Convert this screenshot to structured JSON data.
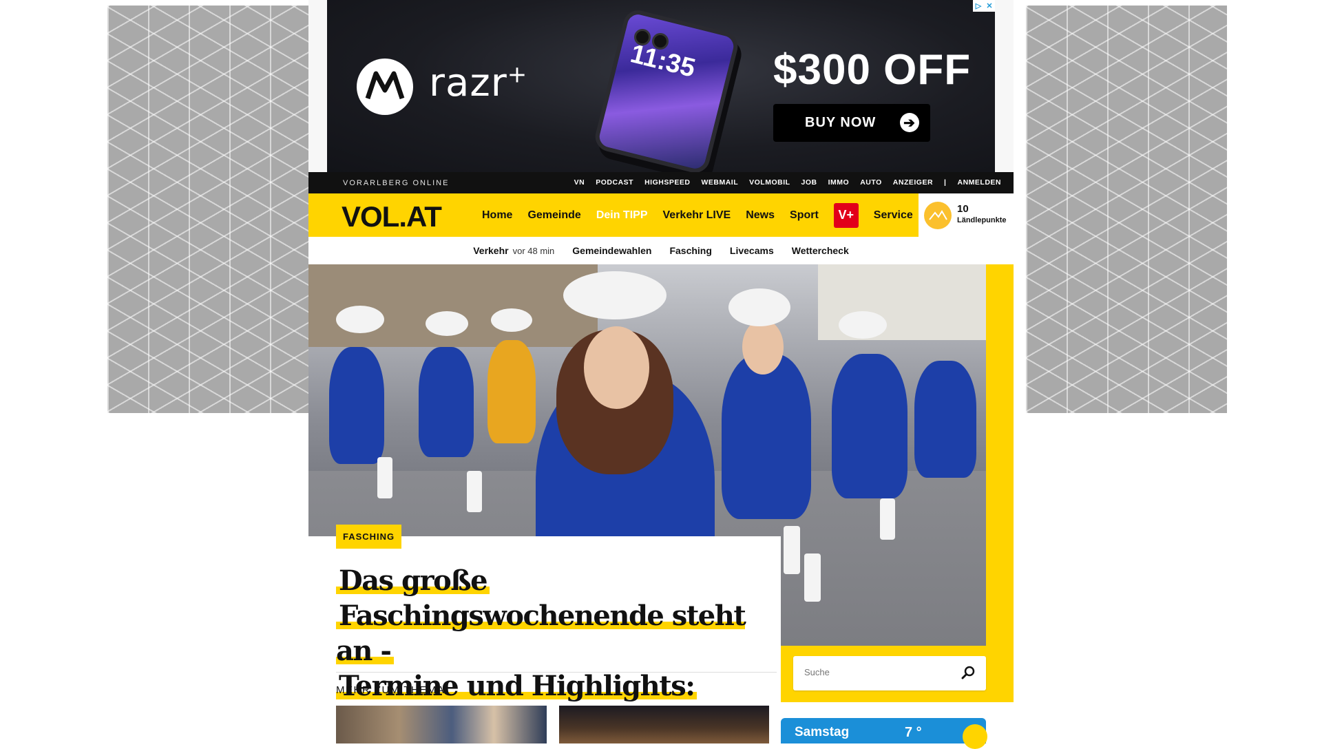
{
  "ad": {
    "brand": "razr",
    "brand_sup": "+",
    "phone_time": "11:35",
    "offer": "$300 OFF",
    "cta": "BUY NOW",
    "choices": [
      "▷",
      "✕"
    ]
  },
  "topbar": {
    "brand": "VORARLBERG ONLINE",
    "links": [
      "VN",
      "PODCAST",
      "HIGHSPEED",
      "WEBMAIL",
      "VOLMOBIL",
      "JOB",
      "IMMO",
      "AUTO",
      "ANZEIGER"
    ],
    "separator": "|",
    "login": "ANMELDEN"
  },
  "mainnav": {
    "logo": "VOL.AT",
    "links": [
      "Home",
      "Gemeinde",
      "Dein TIPP",
      "Verkehr LIVE",
      "News",
      "Sport"
    ],
    "vplus": "V+",
    "service": "Service",
    "points_value": "10",
    "points_label": "Ländlepunkte"
  },
  "subnav": {
    "items": [
      "Verkehr",
      "Gemeindewahlen",
      "Fasching",
      "Livecams",
      "Wettercheck"
    ],
    "verkehr_time": "vor 48 min"
  },
  "article": {
    "tag": "FASCHING",
    "headline_lines": [
      "Das große",
      "Faschingswochenende steht an -",
      "Termine und Highlights:"
    ],
    "mehr_label": "MEHR ZUM THEMA:"
  },
  "search": {
    "placeholder": "Suche"
  },
  "weather": {
    "day": "Samstag",
    "temp": "7 °"
  },
  "colors": {
    "accent_yellow": "#ffd400",
    "topbar_black": "#111111",
    "vplus_red": "#e2001a",
    "weather_blue": "#1b8fd8"
  }
}
